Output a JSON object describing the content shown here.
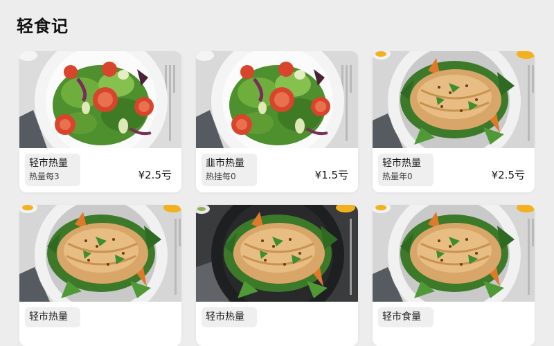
{
  "app": {
    "title": "轻食记"
  },
  "cards": [
    {
      "name": "轻市热量",
      "sub": "热量每3",
      "price": "¥2.5亏",
      "image": "salad-plate-icon"
    },
    {
      "name": "韭市热量",
      "sub": "热挂每0",
      "price": "¥1.5亏",
      "image": "salad-plate-icon"
    },
    {
      "name": "轻市热量",
      "sub": "热量年0",
      "price": "¥2.5亏",
      "image": "chicken-plate-icon"
    },
    {
      "name": "轻市热量",
      "sub": "",
      "price": "",
      "image": "chicken-plate-icon"
    },
    {
      "name": "轻市热量",
      "sub": "",
      "price": "",
      "image": "chicken-dark-plate-icon"
    },
    {
      "name": "轻市食量",
      "sub": "",
      "price": "",
      "image": "chicken-plate-icon"
    }
  ],
  "colors": {
    "background": "#ededed",
    "card": "#ffffff",
    "chip": "#efefef",
    "salad_green": "#4e8f2e",
    "tomato": "#d8452c",
    "chicken": "#d9a66a",
    "dark_plate": "#1e1f20"
  }
}
